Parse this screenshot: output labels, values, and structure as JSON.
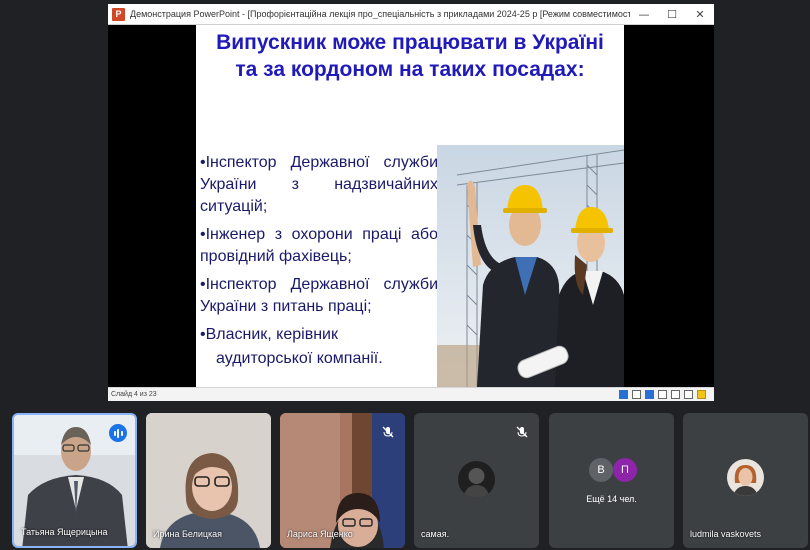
{
  "window": {
    "app_icon": "P",
    "title": "Демонстрация PowerPoint - [Профорієнтаційна лекція про_спеціальність з прикладами 2024-25 р [Режим совместимости]] - Microsoft P...",
    "controls": [
      "—",
      "☐",
      "✕"
    ]
  },
  "slide": {
    "title": "Випускник може працювати в Україні та за кордоном на таких посадах:",
    "bullets": [
      "•Інспектор Державної служби України з надзвичайних ситуацій;",
      "•Інженер з охорони праці або провідний фахівець;",
      "•Інспектор Державної служби України з питань праці;",
      "•Власник, керівник"
    ],
    "bullet_continuation": "аудиторської компанії.",
    "image": "two-engineers-in-hard-hats-photo"
  },
  "statusbar": {
    "slide_counter": "Слайд 4 из 23"
  },
  "participants": [
    {
      "name": "Татьяна Ящерицына",
      "state": "speaking"
    },
    {
      "name": "Ирина Белицкая",
      "state": "video"
    },
    {
      "name": "Лариса Ященко",
      "state": "muted"
    },
    {
      "name": "самая.",
      "state": "muted"
    },
    {
      "name": "Ещё 14 чел.",
      "initials": [
        "В",
        "П"
      ],
      "colors": [
        "#5f6368",
        "#8e24aa"
      ]
    },
    {
      "name": "ludmila vaskovets",
      "state": "avatar"
    }
  ],
  "colors": {
    "title": "#1f1ab8",
    "body": "#1b1a6a",
    "active_border": "#8ab4f8",
    "tile": "#3c4043"
  }
}
